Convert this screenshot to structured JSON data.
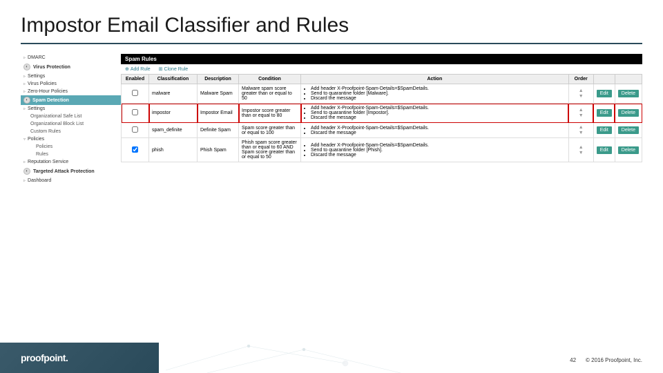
{
  "slide": {
    "title": "Impostor Email Classifier and Rules",
    "page_number": "42",
    "copyright": "© 2016 Proofpoint, Inc.",
    "logo": "proofpoint."
  },
  "sidebar": {
    "items": [
      {
        "label": "DMARC",
        "type": "item",
        "tri": "▹"
      },
      {
        "label": "Virus Protection",
        "type": "section"
      },
      {
        "label": "Settings",
        "type": "item",
        "tri": "▹"
      },
      {
        "label": "Virus Policies",
        "type": "item",
        "tri": "▹"
      },
      {
        "label": "Zero-Hour Policies",
        "type": "item",
        "tri": "▹"
      },
      {
        "label": "Spam Detection",
        "type": "highlighted"
      },
      {
        "label": "Settings",
        "type": "item",
        "tri": "▹"
      },
      {
        "label": "Organizational Safe List",
        "type": "sub"
      },
      {
        "label": "Organizational Block List",
        "type": "sub"
      },
      {
        "label": "Custom Rules",
        "type": "sub"
      },
      {
        "label": "Policies",
        "type": "item",
        "tri": "▿"
      },
      {
        "label": "Policies",
        "type": "sub2"
      },
      {
        "label": "Rules",
        "type": "sub2"
      },
      {
        "label": "Reputation Service",
        "type": "item",
        "tri": "▹"
      },
      {
        "label": "Targeted Attack Protection",
        "type": "section"
      },
      {
        "label": "Dashboard",
        "type": "item",
        "tri": "▹"
      }
    ]
  },
  "table": {
    "header": "Spam Rules",
    "add_rule": "Add Rule",
    "clone_rule": "Clone Rule",
    "columns": [
      "Enabled",
      "Classification",
      "Description",
      "Condition",
      "Action",
      "Order",
      "",
      ""
    ],
    "rows": [
      {
        "enabled": false,
        "classification": "malware",
        "description": "Malware Spam",
        "condition": "Malware spam score greater than or equal to 50",
        "actions": [
          "Add header X-Proofpoint-Spam-Details=$SpamDetails.",
          "Send to quarantine folder [Malware].",
          "Discard the message"
        ],
        "highlight": false
      },
      {
        "enabled": false,
        "classification": "impostor",
        "description": "Impostor Email",
        "condition": "Impostor score greater than or equal to 80",
        "actions": [
          "Add header X-Proofpoint-Spam-Details=$SpamDetails.",
          "Send to quarantine folder [Impostor].",
          "Discard the message"
        ],
        "highlight": true
      },
      {
        "enabled": false,
        "classification": "spam_definite",
        "description": "Definite Spam",
        "condition": "Spam score greater than or equal to 100",
        "actions": [
          "Add header X-Proofpoint-Spam-Details=$SpamDetails.",
          "Discard the message"
        ],
        "highlight": false
      },
      {
        "enabled": true,
        "classification": "phish",
        "description": "Phish Spam",
        "condition": "Phish spam score greater than or equal to 60 AND Spam score greater than or equal to 50",
        "actions": [
          "Add header X-Proofpoint-Spam-Details=$SpamDetails.",
          "Send to quarantine folder [Phish].",
          "Discard the message"
        ],
        "highlight": false
      }
    ],
    "edit_label": "Edit",
    "delete_label": "Delete"
  }
}
